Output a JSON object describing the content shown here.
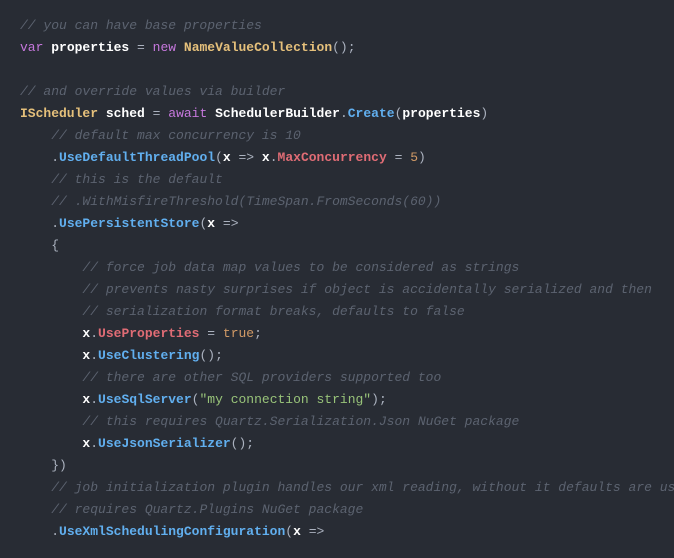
{
  "code": {
    "c1": "// you can have base properties",
    "var": "var",
    "properties": "properties",
    "eq": "=",
    "new": "new",
    "NameValueCollection": "NameValueCollection",
    "parens": "()",
    "semi": ";",
    "c2": "// and override values via builder",
    "IScheduler": "IScheduler",
    "sched": "sched",
    "await": "await",
    "SchedulerBuilder": "SchedulerBuilder",
    "dot": ".",
    "Create": "Create",
    "open": "(",
    "close": ")",
    "c3": "// default max concurrency is 10",
    "UseDefaultThreadPool": "UseDefaultThreadPool",
    "x": "x",
    "arrow": "=>",
    "MaxConcurrency": "MaxConcurrency",
    "five": "5",
    "c4": "// this is the default",
    "c5": "// .WithMisfireThreshold(TimeSpan.FromSeconds(60))",
    "UsePersistentStore": "UsePersistentStore",
    "obrace": "{",
    "cbrace": "}",
    "c6": "// force job data map values to be considered as strings",
    "c7": "// prevents nasty surprises if object is accidentally serialized and then",
    "c8": "// serialization format breaks, defaults to false",
    "UseProperties": "UseProperties",
    "true": "true",
    "UseClustering": "UseClustering",
    "c9": "// there are other SQL providers supported too",
    "UseSqlServer": "UseSqlServer",
    "connstr": "\"my connection string\"",
    "c10": "// this requires Quartz.Serialization.Json NuGet package",
    "UseJsonSerializer": "UseJsonSerializer",
    "c11": "// job initialization plugin handles our xml reading, without it defaults are used",
    "c12": "// requires Quartz.Plugins NuGet package",
    "UseXmlSchedulingConfiguration": "UseXmlSchedulingConfiguration"
  }
}
